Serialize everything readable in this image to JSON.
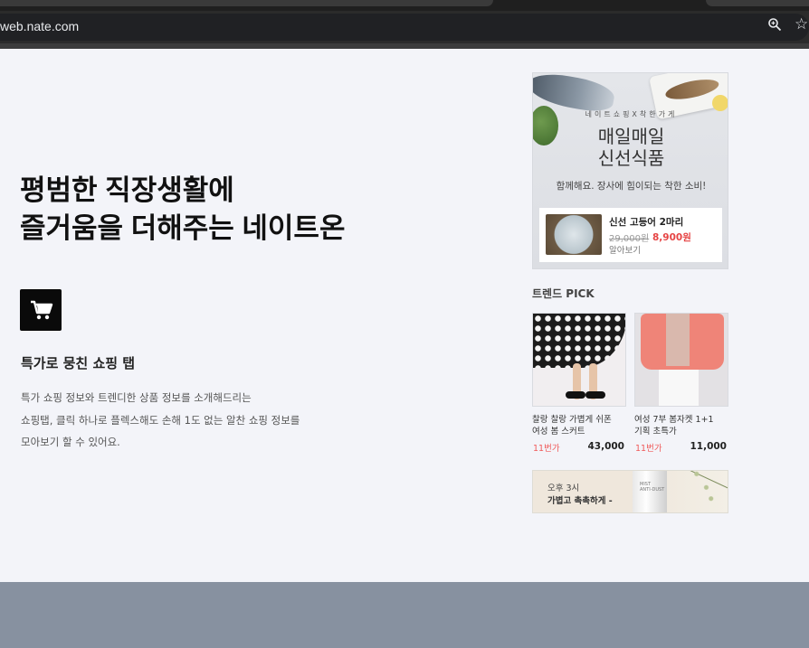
{
  "browser": {
    "url": "web.nate.com",
    "icons": [
      "zoom-icon",
      "bookmark-star-icon"
    ],
    "star_glyph": "☆"
  },
  "hero": {
    "headline_line1": "평범한 직장생활에",
    "headline_line2": "즐거움을 더해주는 네이트온",
    "feature_icon": "shopping-cart-icon",
    "feature_title": "특가로 뭉친 쇼핑 탭",
    "feature_desc_line1": "특가 쇼핑 정보와 트렌디한 상품 정보를 소개해드리는",
    "feature_desc_line2": "쇼핑탭, 클릭 하나로 플렉스해도 손해 1도 없는 알찬 쇼핑 정보를",
    "feature_desc_line3": "모아보기 할 수 있어요."
  },
  "promo": {
    "kicker": "네이트쇼핑X착한가게",
    "title_line1": "매일매일",
    "title_line2": "신선식품",
    "tagline": "함께해요. 장사에 힘이되는 착한 소비!",
    "product_name": "신선 고등어 2마리",
    "old_price": "29,000원",
    "new_price": "8,900원",
    "more_label": "알아보기"
  },
  "trend": {
    "label": "트렌드 PICK",
    "products": [
      {
        "name_line1": "찰랑 찰랑 가볍게 쉬폰",
        "name_line2": "여성 봄 스커트",
        "seller": "11번가",
        "price": "43,000"
      },
      {
        "name_line1": "여성 7부 봄자켓 1+1",
        "name_line2": "기획 초특가",
        "seller": "11번가",
        "price": "11,000"
      }
    ]
  },
  "banner": {
    "time": "오후 3시",
    "copy": "가볍고 촉촉하게 -",
    "bottle_line1": "MIST",
    "bottle_line2": "ANTI-DUST"
  },
  "colors": {
    "page_bg": "#f3f4f9",
    "footer_band": "#8791a0",
    "sale_red": "#e64545",
    "seller_red": "#f05a5a"
  }
}
